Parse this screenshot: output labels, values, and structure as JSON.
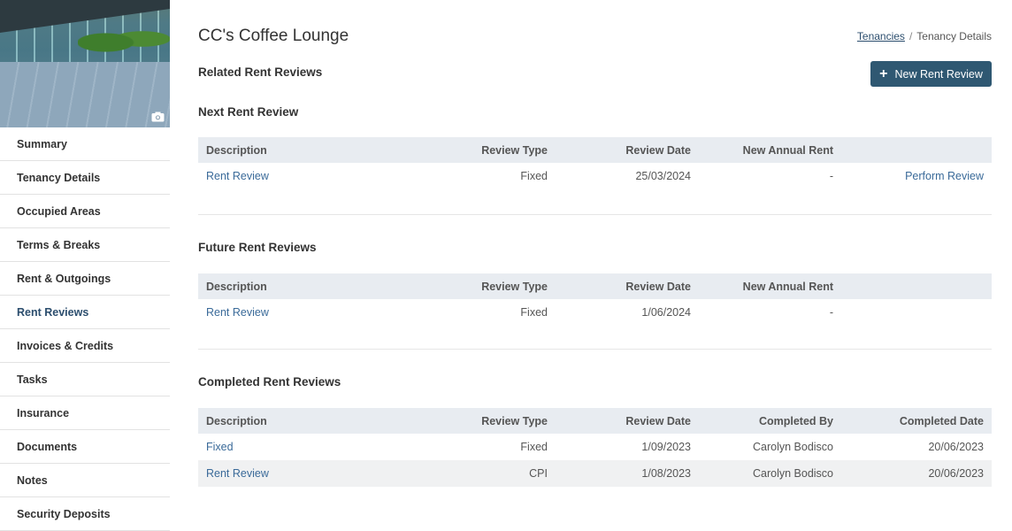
{
  "sidebar": {
    "items": [
      {
        "label": "Summary"
      },
      {
        "label": "Tenancy Details"
      },
      {
        "label": "Occupied Areas"
      },
      {
        "label": "Terms & Breaks"
      },
      {
        "label": "Rent & Outgoings"
      },
      {
        "label": "Rent Reviews",
        "active": true
      },
      {
        "label": "Invoices & Credits"
      },
      {
        "label": "Tasks"
      },
      {
        "label": "Insurance"
      },
      {
        "label": "Documents"
      },
      {
        "label": "Notes"
      },
      {
        "label": "Security Deposits"
      }
    ]
  },
  "header": {
    "title": "CC's Coffee Lounge",
    "breadcrumb": {
      "parent": "Tenancies",
      "separator": "/",
      "current": "Tenancy Details"
    }
  },
  "related_heading": "Related Rent Reviews",
  "new_button_label": "New Rent Review",
  "next": {
    "heading": "Next Rent Review",
    "columns": [
      "Description",
      "Review Type",
      "Review Date",
      "New Annual Rent",
      ""
    ],
    "rows": [
      {
        "description": "Rent Review",
        "type": "Fixed",
        "date": "25/03/2024",
        "rent": "-",
        "action": "Perform Review"
      }
    ]
  },
  "future": {
    "heading": "Future Rent Reviews",
    "columns": [
      "Description",
      "Review Type",
      "Review Date",
      "New Annual Rent",
      ""
    ],
    "rows": [
      {
        "description": "Rent Review",
        "type": "Fixed",
        "date": "1/06/2024",
        "rent": "-"
      }
    ]
  },
  "completed": {
    "heading": "Completed Rent Reviews",
    "columns": [
      "Description",
      "Review Type",
      "Review Date",
      "Completed By",
      "Completed Date"
    ],
    "rows": [
      {
        "description": "Fixed",
        "type": "Fixed",
        "date": "1/09/2023",
        "by": "Carolyn Bodisco",
        "completed": "20/06/2023"
      },
      {
        "description": "Rent Review",
        "type": "CPI",
        "date": "1/08/2023",
        "by": "Carolyn Bodisco",
        "completed": "20/06/2023"
      }
    ]
  },
  "colors": {
    "accent": "#2f5872",
    "link": "#3a6a99",
    "header_bg": "#e8ecf1"
  }
}
